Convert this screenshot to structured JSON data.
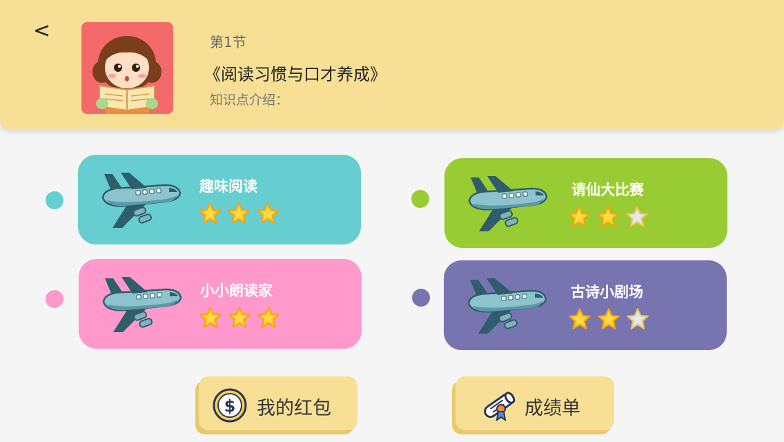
{
  "header": {
    "back_label": "<",
    "lesson_number": "第1节",
    "lesson_title": "《阅读习惯与口才养成》",
    "intro_label": "知识点介绍："
  },
  "activities": [
    {
      "title": "趣味阅读",
      "color": "#66ced0",
      "stars_earned": 3,
      "stars_total": 3
    },
    {
      "title": "请仙大比赛",
      "color": "#99cc33",
      "stars_earned": 2,
      "stars_total": 3
    },
    {
      "title": "小小朗读家",
      "color": "#ff99cc",
      "stars_earned": 3,
      "stars_total": 3
    },
    {
      "title": "古诗小剧场",
      "color": "#7774b0",
      "stars_earned": 2,
      "stars_total": 3
    }
  ],
  "buttons": {
    "red_packet_label": "我的红包",
    "report_label": "成绩单"
  }
}
